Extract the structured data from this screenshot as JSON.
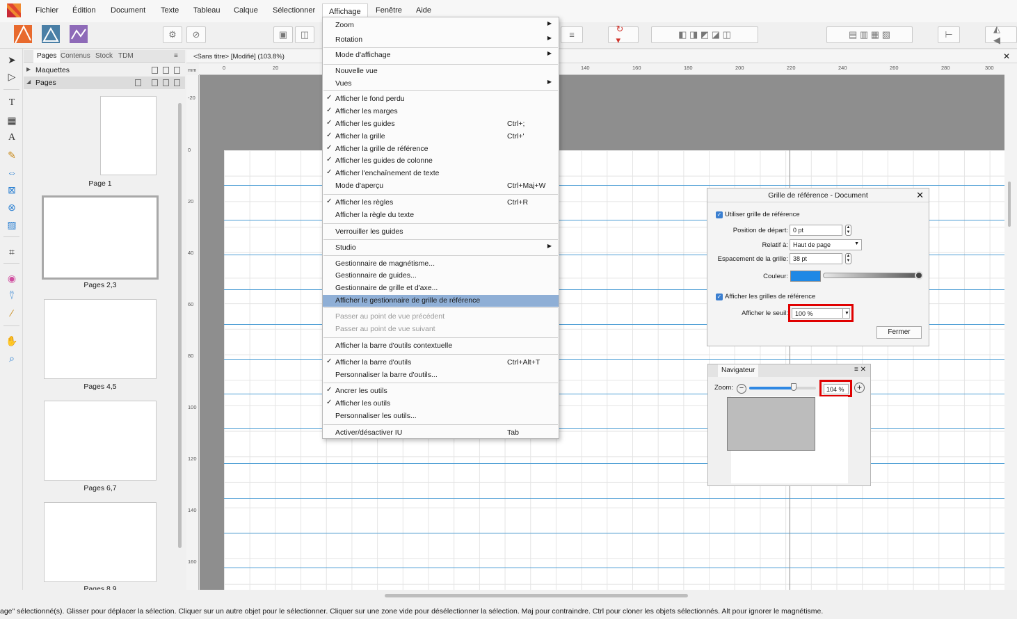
{
  "menubar": {
    "items": [
      "Fichier",
      "Édition",
      "Document",
      "Texte",
      "Tableau",
      "Calque",
      "Sélectionner",
      "Affichage",
      "Fenêtre",
      "Aide"
    ],
    "active": "Affichage"
  },
  "pages_panel": {
    "tabs": [
      "Pages",
      "Contenus",
      "Stock",
      "TDM"
    ],
    "tree": {
      "masters": "Maquettes",
      "pages": "Pages"
    },
    "thumbnails": [
      "Page 1",
      "Pages 2,3",
      "Pages 4,5",
      "Pages 6,7",
      "Pages 8,9"
    ]
  },
  "document": {
    "tab_title": "<Sans titre> [Modifié] (103.8%)",
    "ruler_unit": "mm",
    "h_ruler_labels": [
      "0",
      "20",
      "140",
      "160",
      "180",
      "200",
      "220",
      "240",
      "260",
      "280",
      "300"
    ],
    "v_ruler_labels": [
      "-20",
      "0",
      "20",
      "40",
      "60",
      "80",
      "100",
      "120",
      "140",
      "160"
    ]
  },
  "view_menu": {
    "items": [
      {
        "label": "Zoom",
        "submenu": true
      },
      {
        "label": "Rotation",
        "submenu": true
      },
      {
        "label": "Mode d'affichage",
        "submenu": true
      },
      {
        "label": "Nouvelle vue"
      },
      {
        "label": "Vues",
        "submenu": true
      },
      {
        "label": "Afficher le fond perdu",
        "checked": true
      },
      {
        "label": "Afficher les marges",
        "checked": true
      },
      {
        "label": "Afficher les guides",
        "checked": true,
        "shortcut": "Ctrl+;"
      },
      {
        "label": "Afficher la grille",
        "checked": true,
        "shortcut": "Ctrl+'"
      },
      {
        "label": "Afficher la grille de référence",
        "checked": true
      },
      {
        "label": "Afficher les guides de colonne",
        "checked": true
      },
      {
        "label": "Afficher l'enchaînement de texte",
        "checked": true
      },
      {
        "label": "Mode d'aperçu",
        "shortcut": "Ctrl+Maj+W"
      },
      {
        "label": "Afficher les règles",
        "checked": true,
        "shortcut": "Ctrl+R"
      },
      {
        "label": "Afficher la règle du texte"
      },
      {
        "label": "Verrouiller les guides"
      },
      {
        "label": "Studio",
        "submenu": true
      },
      {
        "label": "Gestionnaire de magnétisme..."
      },
      {
        "label": "Gestionnaire de guides..."
      },
      {
        "label": "Gestionnaire de grille et d'axe..."
      },
      {
        "label": "Afficher le gestionnaire de grille de référence",
        "highlighted": true
      },
      {
        "label": "Passer au point de vue précédent",
        "disabled": true
      },
      {
        "label": "Passer au point de vue suivant",
        "disabled": true
      },
      {
        "label": "Afficher la barre d'outils contextuelle"
      },
      {
        "label": "Afficher la barre d'outils",
        "checked": true,
        "shortcut": "Ctrl+Alt+T"
      },
      {
        "label": "Personnaliser la barre d'outils..."
      },
      {
        "label": "Ancrer les outils",
        "checked": true
      },
      {
        "label": "Afficher les outils",
        "checked": true
      },
      {
        "label": "Personnaliser les outils..."
      },
      {
        "label": "Activer/désactiver IU",
        "shortcut": "Tab"
      }
    ]
  },
  "grid_dialog": {
    "title": "Grille de référence - Document",
    "use_grid_label": "Utiliser grille de référence",
    "start_label": "Position de départ:",
    "start_value": "0 pt",
    "relative_label": "Relatif à:",
    "relative_value": "Haut de page",
    "spacing_label": "Espacement de la grille:",
    "spacing_value": "38 pt",
    "color_label": "Couleur:",
    "color_value": "#1e88e5",
    "show_grids_label": "Afficher les grilles de référence",
    "threshold_label": "Afficher le seuil:",
    "threshold_value": "100 %",
    "close_button": "Fermer"
  },
  "navigator": {
    "title": "Navigateur",
    "zoom_label": "Zoom:",
    "zoom_value": "104 %",
    "zoom_level": 0.67
  },
  "status_bar": {
    "text": "age\" sélectionné(s). Glisser pour déplacer la sélection. Cliquer sur un autre objet pour le sélectionner. Cliquer sur une zone vide pour désélectionner la sélection. Maj pour contraindre. Ctrl pour cloner les objets sélectionnés. Alt pour ignorer le magnétisme."
  },
  "colors": {
    "accent": "#1e88e5",
    "highlight": "#8fafd6",
    "annotation_red": "#e00000",
    "baseline_blue": "#4a9cd4"
  }
}
